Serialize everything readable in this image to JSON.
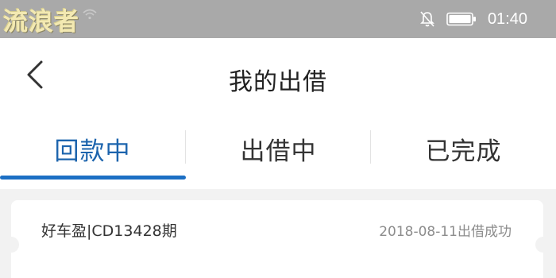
{
  "status_bar": {
    "watermark": "流浪者",
    "time": "01:40",
    "icons": [
      "wifi-icon",
      "notifications-off-icon",
      "battery-icon"
    ]
  },
  "header": {
    "title": "我的出借",
    "back_icon": "chevron-left-icon"
  },
  "tabs": [
    {
      "label": "回款中",
      "active": true
    },
    {
      "label": "出借中",
      "active": false
    },
    {
      "label": "已完成",
      "active": false
    }
  ],
  "loans": [
    {
      "name": "好车盈|CD13428期",
      "status": "2018-08-11出借成功"
    }
  ],
  "colors": {
    "status_bar_bg": "#a9a9a9",
    "accent": "#1c64ad",
    "page_bg": "#f2f2f2"
  }
}
